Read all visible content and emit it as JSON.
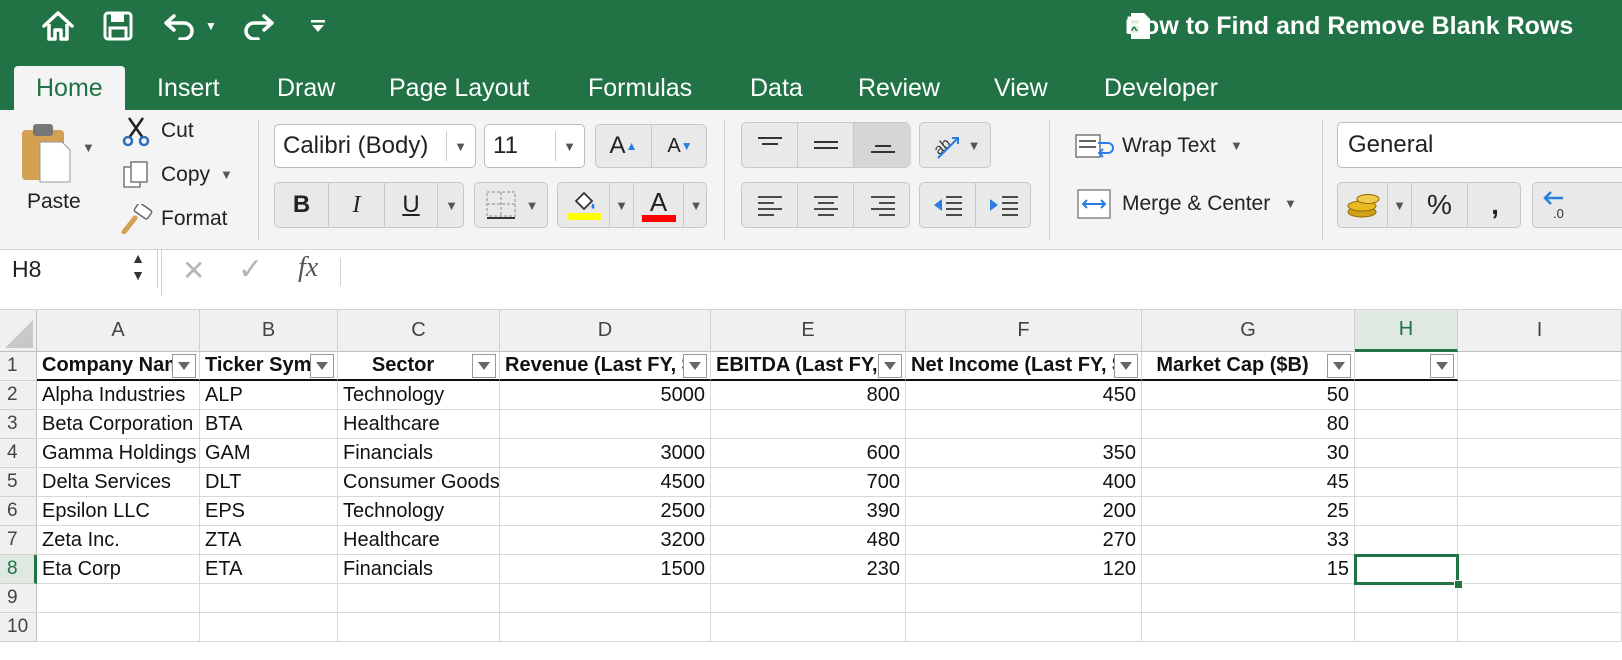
{
  "window": {
    "title": "How to Find and Remove Blank Rows"
  },
  "quick_access": {
    "home": "home-icon",
    "save": "save-icon",
    "undo": "undo-icon",
    "redo": "redo-icon",
    "customize": "customize-icon"
  },
  "tabs": [
    "Home",
    "Insert",
    "Draw",
    "Page Layout",
    "Formulas",
    "Data",
    "Review",
    "View",
    "Developer"
  ],
  "clipboard": {
    "paste": "Paste",
    "cut": "Cut",
    "copy": "Copy",
    "format": "Format"
  },
  "font": {
    "name": "Calibri (Body)",
    "size": "11",
    "bold": "B",
    "italic": "I",
    "underline": "U",
    "font_color_glyph": "A",
    "highlight_color": "#ffff00",
    "font_color": "#ff0000"
  },
  "alignment": {
    "wrap_text": "Wrap Text",
    "merge_center": "Merge & Center"
  },
  "number": {
    "format": "General"
  },
  "formula_bar": {
    "name_box": "H8",
    "fx": "fx",
    "value": ""
  },
  "grid": {
    "columns": [
      "A",
      "B",
      "C",
      "D",
      "E",
      "F",
      "G",
      "H",
      "I"
    ],
    "rows": [
      "1",
      "2",
      "3",
      "4",
      "5",
      "6",
      "7",
      "8",
      "9",
      "10"
    ],
    "selected_cell": "H8",
    "headers": [
      "Company Nam",
      "Ticker Symb",
      "Sector",
      "Revenue (Last FY, $",
      "EBITDA (Last FY, $",
      "Net Income (Last FY, $",
      "Market Cap ($B)",
      ""
    ],
    "data": [
      [
        "Alpha Industries",
        "ALP",
        "Technology",
        "5000",
        "800",
        "450",
        "50"
      ],
      [
        "Beta Corporation",
        "BTA",
        "Healthcare",
        "",
        "",
        "",
        "80"
      ],
      [
        "Gamma Holdings",
        "GAM",
        "Financials",
        "3000",
        "600",
        "350",
        "30"
      ],
      [
        "Delta Services",
        "DLT",
        "Consumer Goods",
        "4500",
        "700",
        "400",
        "45"
      ],
      [
        "Epsilon LLC",
        "EPS",
        "Technology",
        "2500",
        "390",
        "200",
        "25"
      ],
      [
        "Zeta Inc.",
        "ZTA",
        "Healthcare",
        "3200",
        "480",
        "270",
        "33"
      ],
      [
        "Eta Corp",
        "ETA",
        "Financials",
        "1500",
        "230",
        "120",
        "15"
      ]
    ]
  },
  "colors": {
    "brand": "#217346",
    "selection": "#217346"
  }
}
